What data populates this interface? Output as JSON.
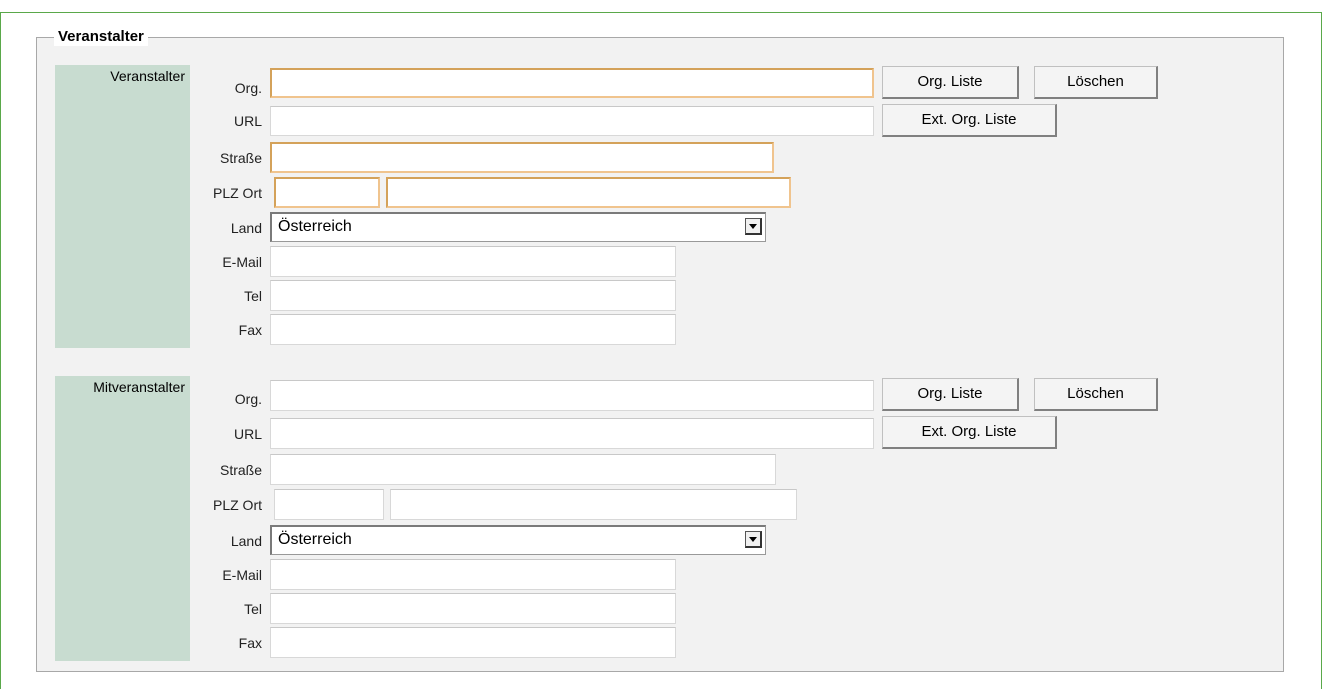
{
  "legend": "Veranstalter",
  "sections": [
    {
      "title": "Veranstalter",
      "labels": {
        "org": "Org.",
        "url": "URL",
        "street": "Straße",
        "plz_ort": "PLZ Ort",
        "land": "Land",
        "email": "E-Mail",
        "tel": "Tel",
        "fax": "Fax"
      },
      "values": {
        "org": "",
        "url": "",
        "street": "",
        "plz": "",
        "ort": "",
        "land": "Österreich",
        "email": "",
        "tel": "",
        "fax": ""
      },
      "buttons": {
        "org_liste": "Org. Liste",
        "loeschen": "Löschen",
        "ext_org_liste": "Ext. Org. Liste"
      }
    },
    {
      "title": "Mitveranstalter",
      "labels": {
        "org": "Org.",
        "url": "URL",
        "street": "Straße",
        "plz_ort": "PLZ Ort",
        "land": "Land",
        "email": "E-Mail",
        "tel": "Tel",
        "fax": "Fax"
      },
      "values": {
        "org": "",
        "url": "",
        "street": "",
        "plz": "",
        "ort": "",
        "land": "Österreich",
        "email": "",
        "tel": "",
        "fax": ""
      },
      "buttons": {
        "org_liste": "Org. Liste",
        "loeschen": "Löschen",
        "ext_org_liste": "Ext. Org. Liste"
      }
    }
  ],
  "colors": {
    "frame_border": "#5aa84a",
    "section_label_bg": "#c8dcd0",
    "required_border": "#f0c48e"
  }
}
